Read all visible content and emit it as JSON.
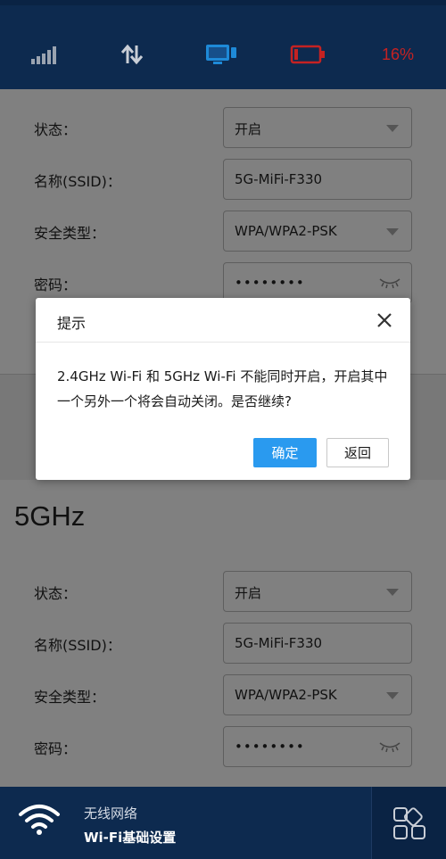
{
  "status_bar": {
    "battery_percent": "16%",
    "battery_level": 0.16,
    "colors": {
      "background": "#0d2a4f",
      "battery_alert": "#c52222",
      "screen": "#1e8ad8"
    }
  },
  "band_24": {
    "rows": [
      {
        "label": "状态：",
        "value": "开启",
        "type": "select"
      },
      {
        "label": "名称(SSID)：",
        "value": "5G-MiFi-F330",
        "type": "text"
      },
      {
        "label": "安全类型：",
        "value": "WPA/WPA2-PSK",
        "type": "select"
      },
      {
        "label": "密码：",
        "value": "••••••••",
        "type": "password"
      }
    ]
  },
  "band_5g": {
    "title": "5GHz",
    "rows": [
      {
        "label": "状态：",
        "value": "开启",
        "type": "select"
      },
      {
        "label": "名称(SSID)：",
        "value": "5G-MiFi-F330",
        "type": "text"
      },
      {
        "label": "安全类型：",
        "value": "WPA/WPA2-PSK",
        "type": "select"
      },
      {
        "label": "密码：",
        "value": "••••••••",
        "type": "password"
      }
    ]
  },
  "dialog": {
    "title": "提示",
    "message": "2.4GHz Wi-Fi 和 5GHz Wi-Fi 不能同时开启，开启其中一个另外一个将会自动关闭。是否继续?",
    "confirm_label": "确定",
    "back_label": "返回",
    "colors": {
      "confirm": "#2a9aef"
    }
  },
  "bottom_nav": {
    "section": "无线网络",
    "page": "Wi-Fi基础设置"
  }
}
